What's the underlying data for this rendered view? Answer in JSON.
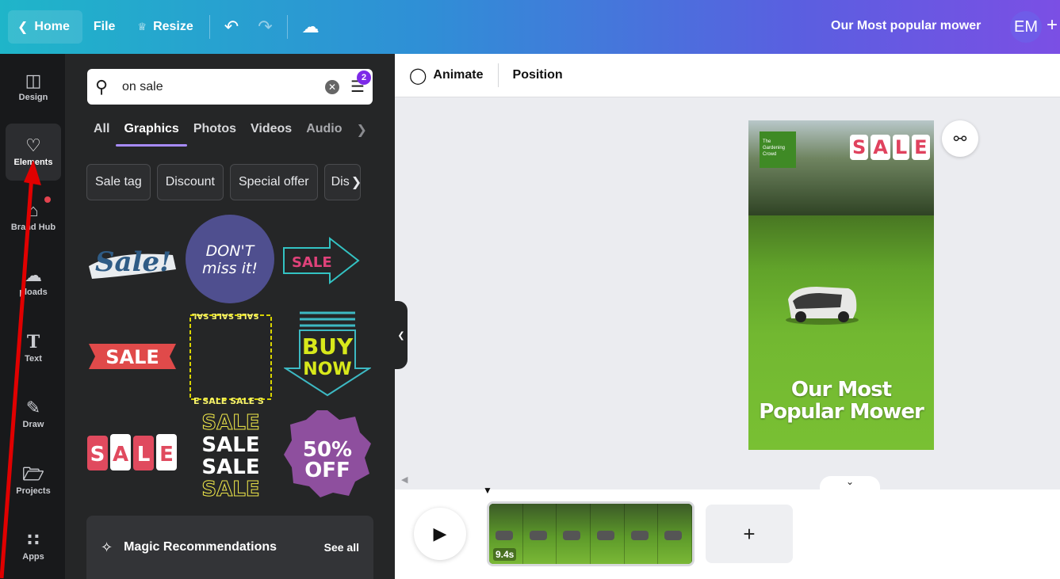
{
  "topbar": {
    "home_label": "Home",
    "file_label": "File",
    "resize_label": "Resize",
    "design_title": "Our Most popular mower",
    "avatar_initials": "EM"
  },
  "rail": {
    "items": [
      {
        "label": "Design",
        "icon": "layout-icon"
      },
      {
        "label": "Elements",
        "icon": "shapes-icon"
      },
      {
        "label": "Brand Hub",
        "icon": "brand-icon"
      },
      {
        "label": "Uploads",
        "icon": "cloud-upload-icon"
      },
      {
        "label": "Text",
        "icon": "text-icon"
      },
      {
        "label": "Draw",
        "icon": "pen-icon"
      },
      {
        "label": "Projects",
        "icon": "folder-icon"
      },
      {
        "label": "Apps",
        "icon": "grid-icon"
      }
    ],
    "visible_labels": [
      "Design",
      "Elements",
      "Brand Hub",
      "ploads",
      "Text",
      "Draw",
      "Projects",
      "Apps"
    ]
  },
  "panel": {
    "search_value": "on sale",
    "filter_count": "2",
    "tabs": [
      "All",
      "Graphics",
      "Photos",
      "Videos",
      "Audio"
    ],
    "active_tab": "Graphics",
    "chips": [
      "Sale tag",
      "Discount",
      "Special offer",
      "Dis"
    ],
    "graphics": [
      {
        "name": "sale-brush-graphic",
        "text": "Sale!"
      },
      {
        "name": "dont-miss-it-graphic",
        "text": "DON'T miss it!"
      },
      {
        "name": "sale-arrow-graphic",
        "text": "SALE"
      },
      {
        "name": "sale-ribbon-graphic",
        "text": "SALE"
      },
      {
        "name": "sale-frame-graphic",
        "text": "SALE SALE SALE"
      },
      {
        "name": "buy-now-graphic",
        "text": "BUY NOW"
      },
      {
        "name": "sale-letters-graphic",
        "text": "SALE"
      },
      {
        "name": "sale-stack-graphic",
        "text": "SALE"
      },
      {
        "name": "fifty-off-graphic",
        "text": "50% OFF"
      }
    ],
    "magic_label": "Magic Recommendations",
    "see_all_label": "See all"
  },
  "canvas_toolbar": {
    "animate_label": "Animate",
    "position_label": "Position"
  },
  "page": {
    "brand_text": "The Gardening Crowd",
    "sale_letters": [
      "S",
      "A",
      "L",
      "E"
    ],
    "headline_line1": "Our Most",
    "headline_line2": "Popular Mower"
  },
  "timeline": {
    "duration": "9.4s",
    "add_label": "+"
  },
  "colors": {
    "accent": "#7d2ae8",
    "annotation": "#e00000"
  }
}
